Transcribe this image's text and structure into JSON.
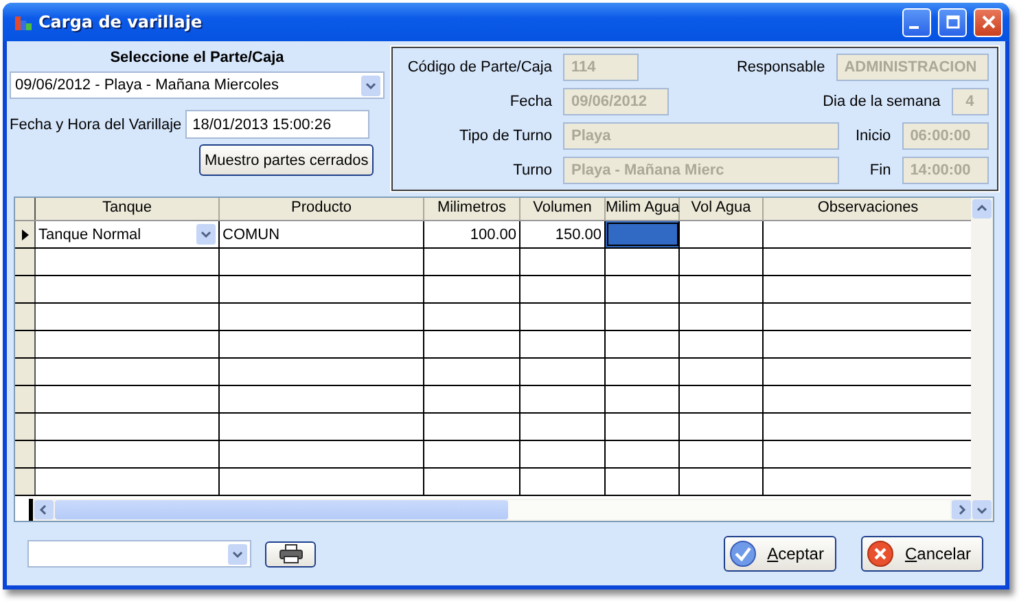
{
  "window": {
    "title": "Carga de varillaje"
  },
  "selector": {
    "heading": "Seleccione el Parte/Caja",
    "value": "09/06/2012 - Playa - Mañana Miercoles",
    "datetime_label": "Fecha y Hora del Varillaje",
    "datetime_value": "18/01/2013 15:00:26",
    "closed_button": "Muestro partes cerrados"
  },
  "info": {
    "rows": [
      {
        "label": "Código de Parte/Caja",
        "value": "114",
        "right_label": "Responsable",
        "right_value": "ADMINISTRACION",
        "disabled": true
      },
      {
        "label": "Fecha",
        "value": "09/06/2012",
        "right_label": "Dia de la semana",
        "right_value": "4",
        "disabled": true
      },
      {
        "label": "Tipo de Turno",
        "value": "Playa",
        "right_label": "Inicio",
        "right_value": "06:00:00",
        "disabled": true
      },
      {
        "label": "Turno",
        "value": "Playa - Mañana Mierc",
        "right_label": "Fin",
        "right_value": "14:00:00",
        "disabled": true
      }
    ]
  },
  "grid": {
    "columns": [
      "Tanque",
      "Producto",
      "Milimetros",
      "Volumen",
      "Milim Agua",
      "Vol Agua",
      "Observaciones"
    ],
    "rows": [
      {
        "current": true,
        "cells": [
          {
            "kind": "dropdown",
            "value": "Tanque Normal",
            "selected": false
          },
          {
            "kind": "text",
            "value": "COMUN",
            "selected": false
          },
          {
            "kind": "number",
            "value": "100.00",
            "selected": false
          },
          {
            "kind": "number",
            "value": "150.00",
            "selected": false
          },
          {
            "kind": "number",
            "selected": true
          },
          {
            "kind": "number",
            "selected": false
          },
          {
            "kind": "text",
            "selected": false
          }
        ]
      }
    ]
  },
  "buttons": [
    {
      "kind": "ok",
      "mnemonic": "A",
      "rest": "ceptar"
    },
    {
      "kind": "cancel",
      "mnemonic": "C",
      "rest": "ancelar"
    }
  ]
}
